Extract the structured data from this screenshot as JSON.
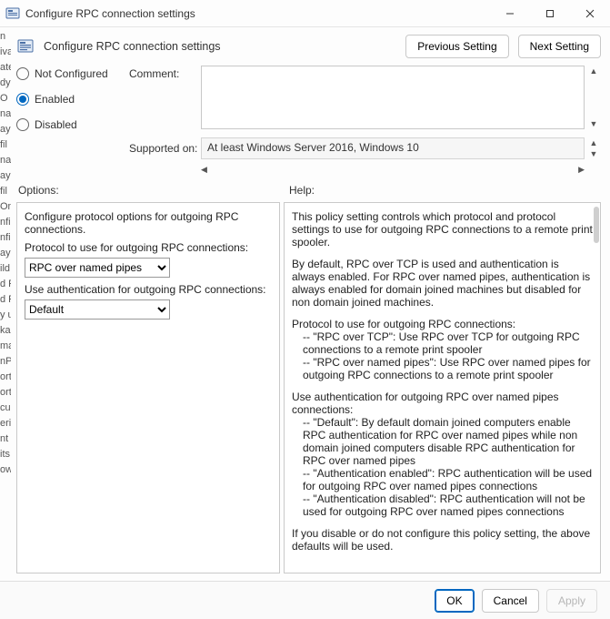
{
  "window": {
    "title": "Configure RPC connection settings"
  },
  "header": {
    "title": "Configure RPC connection settings",
    "prev_btn": "Previous Setting",
    "next_btn": "Next Setting"
  },
  "state": {
    "radios": {
      "not_configured": "Not Configured",
      "enabled": "Enabled",
      "disabled": "Disabled",
      "selected": "enabled"
    },
    "comment_label": "Comment:",
    "comment_value": "",
    "supported_label": "Supported on:",
    "supported_value": "At least Windows Server 2016, Windows 10"
  },
  "labels": {
    "options": "Options:",
    "help": "Help:"
  },
  "options": {
    "intro": "Configure protocol options for outgoing RPC connections.",
    "protocol_label": "Protocol to use for outgoing RPC connections:",
    "protocol_value": "RPC over named pipes",
    "protocol_choices": [
      "RPC over TCP",
      "RPC over named pipes"
    ],
    "auth_label": "Use authentication for outgoing RPC connections:",
    "auth_value": "Default",
    "auth_choices": [
      "Default",
      "Authentication enabled",
      "Authentication disabled"
    ]
  },
  "help": {
    "p1": "This policy setting controls which protocol and protocol settings to use for outgoing RPC connections to a remote print spooler.",
    "p2": "By default, RPC over TCP is used and authentication is always enabled. For RPC over named pipes, authentication is always enabled for domain joined machines but disabled for non domain joined machines.",
    "p3": "Protocol to use for outgoing RPC connections:",
    "p3a": "-- \"RPC over TCP\": Use RPC over TCP for outgoing RPC connections to a remote print spooler",
    "p3b": "-- \"RPC over named pipes\": Use RPC over named pipes for outgoing RPC connections to a remote print spooler",
    "p4": "Use authentication for outgoing RPC over named pipes connections:",
    "p4a": "-- \"Default\": By default domain joined computers enable RPC authentication for RPC over named pipes while non domain joined computers disable RPC authentication for RPC over named pipes",
    "p4b": "-- \"Authentication enabled\": RPC authentication will be used for outgoing RPC over named pipes connections",
    "p4c": "-- \"Authentication disabled\": RPC authentication will not be used for outgoing RPC over named pipes connections",
    "p5": "If you disable or do not configure this policy setting, the above defaults will be used."
  },
  "footer": {
    "ok": "OK",
    "cancel": "Cancel",
    "apply": "Apply"
  },
  "sliver": [
    "n",
    "iva",
    "ate",
    "dy",
    "O",
    "na",
    "ay",
    "fil",
    "na",
    "ay",
    "fil",
    "On",
    "nfi",
    "nfi",
    "ay",
    "ild",
    "d P",
    "d P",
    "y u",
    "ka",
    "ma",
    "nP",
    "ort",
    "ort",
    "cu",
    "eri",
    "nt",
    "its",
    "ow"
  ]
}
